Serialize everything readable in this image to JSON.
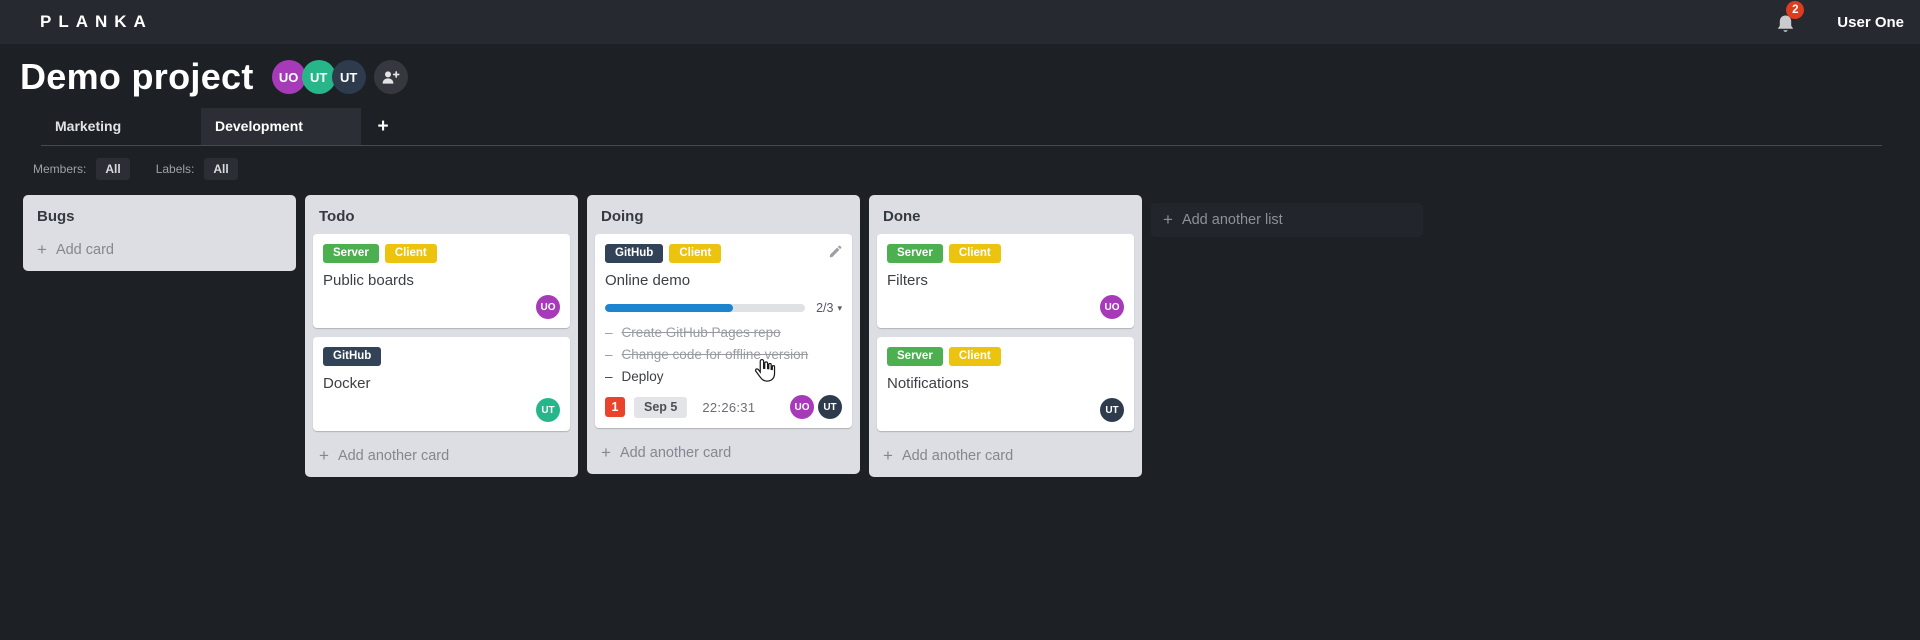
{
  "topbar": {
    "logo": "PLANKA",
    "notifications_count": "2",
    "user_name": "User One"
  },
  "project": {
    "title": "Demo project",
    "members": [
      {
        "initials": "UO",
        "color": "#a63ab8"
      },
      {
        "initials": "UT",
        "color": "#27b68a"
      },
      {
        "initials": "UT",
        "color": "#2d3b4d"
      }
    ]
  },
  "tabs": {
    "items": [
      {
        "label": "Marketing"
      },
      {
        "label": "Development"
      }
    ]
  },
  "filters": {
    "members_label": "Members:",
    "members_value": "All",
    "labels_label": "Labels:",
    "labels_value": "All"
  },
  "glyphs": {
    "plus": "+",
    "chevron_down": "▾",
    "task_bullet": "–"
  },
  "colors": {
    "badge_red": "#e9432c",
    "progress_blue": "#1d84d0",
    "label_green": "#4caf50",
    "label_yellow": "#ecc30f",
    "label_navy": "#334357"
  },
  "board": {
    "add_list_label": "Add another list",
    "lists": [
      {
        "title": "Bugs",
        "footer": "Add card",
        "cards": []
      },
      {
        "title": "Todo",
        "footer": "Add another card",
        "cards": [
          {
            "title": "Public boards",
            "labels": [
              {
                "name": "Server",
                "color": "#4caf50"
              },
              {
                "name": "Client",
                "color": "#ecc30f"
              }
            ],
            "members": [
              {
                "initials": "UO",
                "color": "#a63ab8"
              }
            ]
          },
          {
            "title": "Docker",
            "labels": [
              {
                "name": "GitHub",
                "color": "#334357"
              }
            ],
            "members": [
              {
                "initials": "UT",
                "color": "#27b68a"
              }
            ]
          }
        ]
      },
      {
        "title": "Doing",
        "footer": "Add another card",
        "cards": [
          {
            "title": "Online demo",
            "labels": [
              {
                "name": "GitHub",
                "color": "#334357"
              },
              {
                "name": "Client",
                "color": "#ecc30f"
              }
            ],
            "progress": {
              "percent": 64,
              "text": "2/3"
            },
            "tasks": [
              {
                "text": "Create GitHub Pages repo",
                "done": true
              },
              {
                "text": "Change code for offline version",
                "done": true
              },
              {
                "text": "Deploy",
                "done": false
              }
            ],
            "notification_count": "1",
            "due_date": "Sep 5",
            "timer": "22:26:31",
            "members": [
              {
                "initials": "UO",
                "color": "#a63ab8"
              },
              {
                "initials": "UT",
                "color": "#2d3b4d"
              }
            ]
          }
        ]
      },
      {
        "title": "Done",
        "footer": "Add another card",
        "cards": [
          {
            "title": "Filters",
            "labels": [
              {
                "name": "Server",
                "color": "#4caf50"
              },
              {
                "name": "Client",
                "color": "#ecc30f"
              }
            ],
            "members": [
              {
                "initials": "UO",
                "color": "#a63ab8"
              }
            ]
          },
          {
            "title": "Notifications",
            "labels": [
              {
                "name": "Server",
                "color": "#4caf50"
              },
              {
                "name": "Client",
                "color": "#ecc30f"
              }
            ],
            "members": [
              {
                "initials": "UT",
                "color": "#2d3b4d"
              }
            ]
          }
        ]
      }
    ]
  }
}
